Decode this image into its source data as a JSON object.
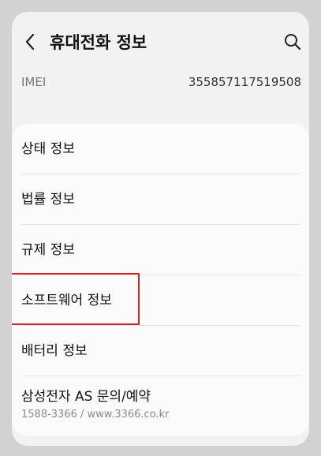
{
  "header": {
    "title": "휴대전화 정보"
  },
  "imei": {
    "label": "IMEI",
    "value": "355857117519508"
  },
  "menu": {
    "items": [
      {
        "label": "상태 정보"
      },
      {
        "label": "법률 정보"
      },
      {
        "label": "규제 정보"
      },
      {
        "label": "소프트웨어 정보"
      },
      {
        "label": "배터리 정보"
      },
      {
        "label": "삼성전자 AS 문의/예약",
        "sub": "1588-3366 / www.3366.co.kr"
      }
    ]
  },
  "highlight_color": "#e02020",
  "icons": {
    "back": "chevron-left-icon",
    "search": "search-icon"
  }
}
